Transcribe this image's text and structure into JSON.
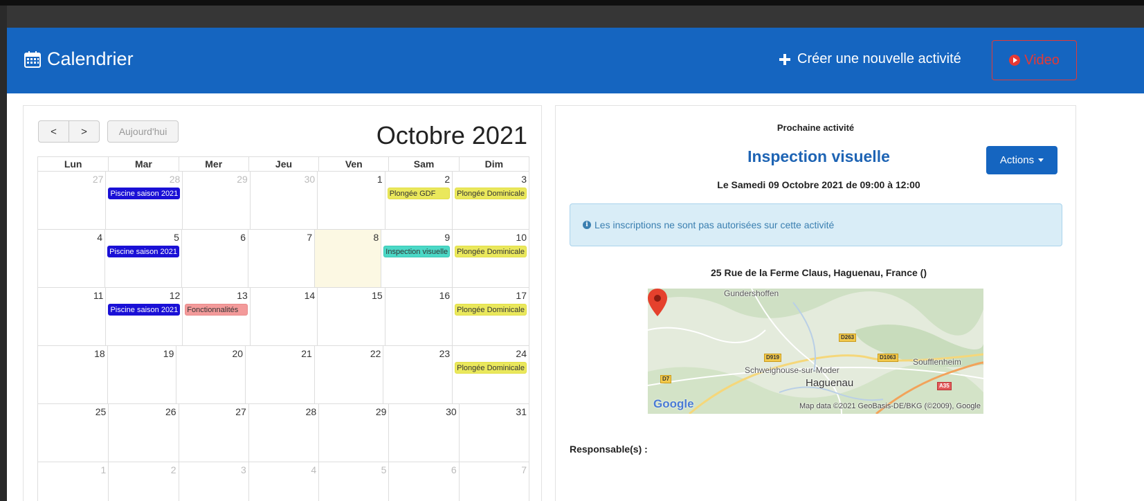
{
  "header": {
    "title": "Calendrier",
    "create_label": "Créer une nouvelle activité",
    "video_label": "Video",
    "colors": {
      "bar": "#1565c0",
      "video": "#e53935"
    }
  },
  "calendar": {
    "prev_label": "<",
    "next_label": ">",
    "today_label": "Aujourd'hui",
    "month_title": "Octobre 2021",
    "weekdays": [
      "Lun",
      "Mar",
      "Mer",
      "Jeu",
      "Ven",
      "Sam",
      "Dim"
    ],
    "weeks": [
      [
        {
          "n": "27",
          "other": true
        },
        {
          "n": "28",
          "other": true,
          "events": [
            {
              "label": "Piscine saison 2021",
              "color": "blue"
            }
          ]
        },
        {
          "n": "29",
          "other": true
        },
        {
          "n": "30",
          "other": true
        },
        {
          "n": "1"
        },
        {
          "n": "2",
          "events": [
            {
              "label": "Plongée GDF",
              "color": "yellow"
            }
          ]
        },
        {
          "n": "3",
          "events": [
            {
              "label": "Plongée Dominicale",
              "color": "yellow"
            }
          ]
        }
      ],
      [
        {
          "n": "4"
        },
        {
          "n": "5",
          "events": [
            {
              "label": "Piscine saison 2021",
              "color": "blue"
            }
          ]
        },
        {
          "n": "6"
        },
        {
          "n": "7"
        },
        {
          "n": "8",
          "today": true
        },
        {
          "n": "9",
          "events": [
            {
              "label": "Inspection visuelle",
              "color": "teal"
            }
          ]
        },
        {
          "n": "10",
          "events": [
            {
              "label": "Plongée Dominicale",
              "color": "yellow"
            }
          ]
        }
      ],
      [
        {
          "n": "11"
        },
        {
          "n": "12",
          "events": [
            {
              "label": "Piscine saison 2021",
              "color": "blue"
            }
          ]
        },
        {
          "n": "13",
          "events": [
            {
              "label": "Fonctionnalités",
              "color": "pink"
            }
          ]
        },
        {
          "n": "14"
        },
        {
          "n": "15"
        },
        {
          "n": "16"
        },
        {
          "n": "17",
          "events": [
            {
              "label": "Plongée Dominicale",
              "color": "yellow"
            }
          ]
        }
      ],
      [
        {
          "n": "18"
        },
        {
          "n": "19"
        },
        {
          "n": "20"
        },
        {
          "n": "21"
        },
        {
          "n": "22"
        },
        {
          "n": "23"
        },
        {
          "n": "24",
          "events": [
            {
              "label": "Plongée Dominicale",
              "color": "yellow"
            }
          ]
        }
      ],
      [
        {
          "n": "25"
        },
        {
          "n": "26"
        },
        {
          "n": "27"
        },
        {
          "n": "28"
        },
        {
          "n": "29"
        },
        {
          "n": "30"
        },
        {
          "n": "31"
        }
      ],
      [
        {
          "n": "1",
          "other": true
        },
        {
          "n": "2",
          "other": true
        },
        {
          "n": "3",
          "other": true
        },
        {
          "n": "4",
          "other": true
        },
        {
          "n": "5",
          "other": true
        },
        {
          "n": "6",
          "other": true
        },
        {
          "n": "7",
          "other": true
        }
      ]
    ]
  },
  "activity": {
    "next_label": "Prochaine activité",
    "name": "Inspection visuelle",
    "actions_label": "Actions",
    "date": "Le Samedi 09 Octobre 2021 de 09:00 à 12:00",
    "alert": "Les inscriptions ne sont pas autorisées sur cette activité",
    "address": "25 Rue de la Ferme Claus, Haguenau, France ()",
    "responsables_label": "Responsable(s) :"
  },
  "map": {
    "places": {
      "gundershoffen": "Gundershoffen",
      "schweighouse": "Schweighouse-sur-Moder",
      "haguenau": "Haguenau",
      "soufflenheim": "Soufflenheim"
    },
    "roads": {
      "d263": "D263",
      "d919": "D919",
      "d1063": "D1063",
      "d7": "D7",
      "a35": "A35"
    },
    "logo": "Google",
    "credit": "Map data ©2021 GeoBasis-DE/BKG (©2009), Google"
  }
}
